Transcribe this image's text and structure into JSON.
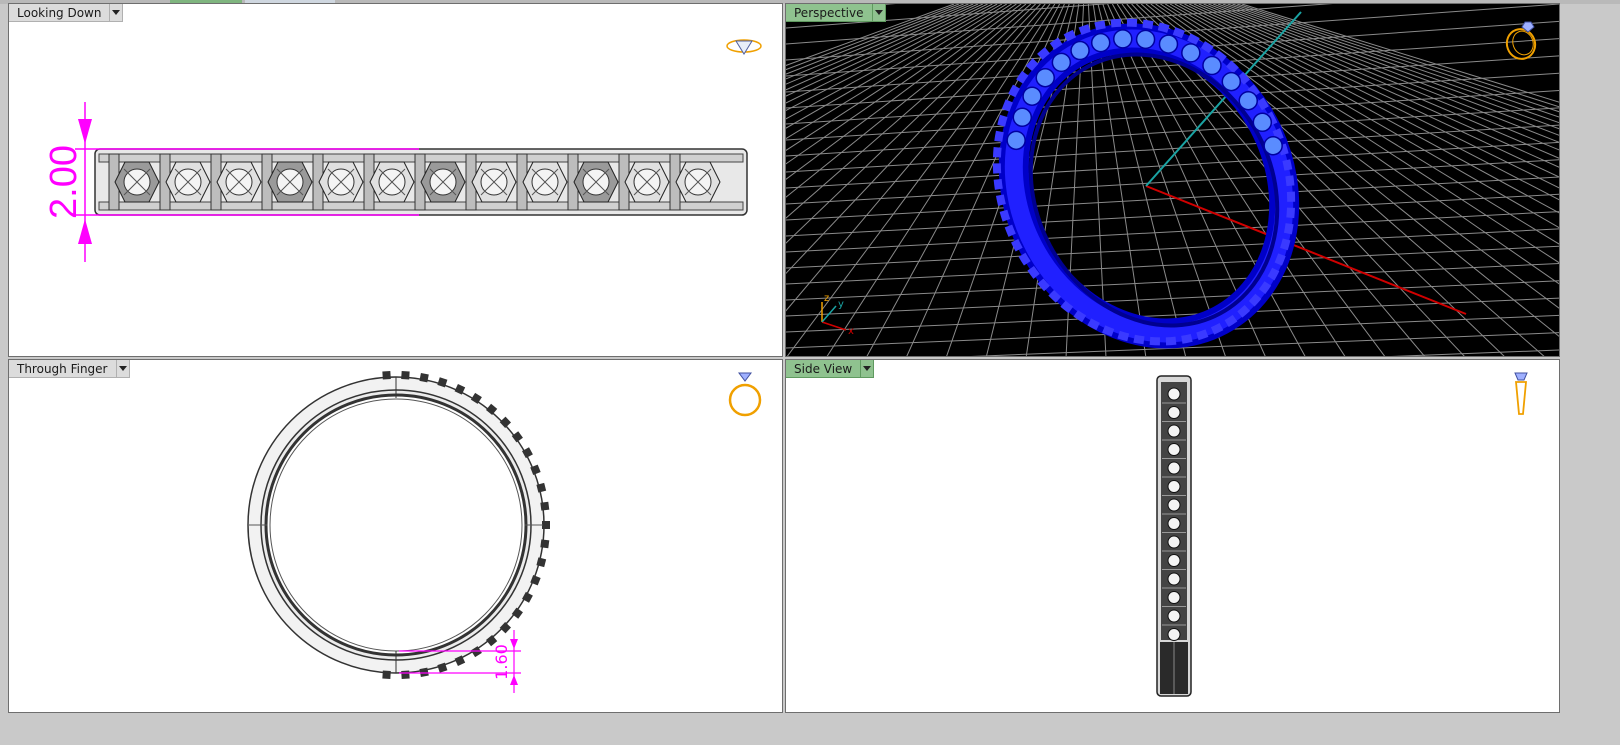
{
  "viewports": {
    "top_left": {
      "label": "Looking Down",
      "active": false,
      "dimension": "2.00"
    },
    "top_right": {
      "label": "Perspective",
      "active": true,
      "axes": {
        "z": "z",
        "y": "y",
        "x": "x"
      }
    },
    "bottom_left": {
      "label": "Through Finger",
      "active": false,
      "dimension": "1.60"
    },
    "bottom_right": {
      "label": "Side View",
      "active": true
    }
  },
  "icons": {
    "top_left": "ring-top-view-icon",
    "top_right": "ring-perspective-icon",
    "bottom_left": "ring-front-view-icon",
    "bottom_right": "ring-side-view-icon",
    "dropdown": "chevron-down-icon"
  },
  "colors": {
    "dimension": "#ff00ff",
    "ring_blue": "#0000ff",
    "grid": "#8a8a8a",
    "axis_x": "#d00000",
    "axis_y": "#1aa3a3",
    "active_tab": "#8fc28f",
    "icon_gold": "#f0a000"
  }
}
